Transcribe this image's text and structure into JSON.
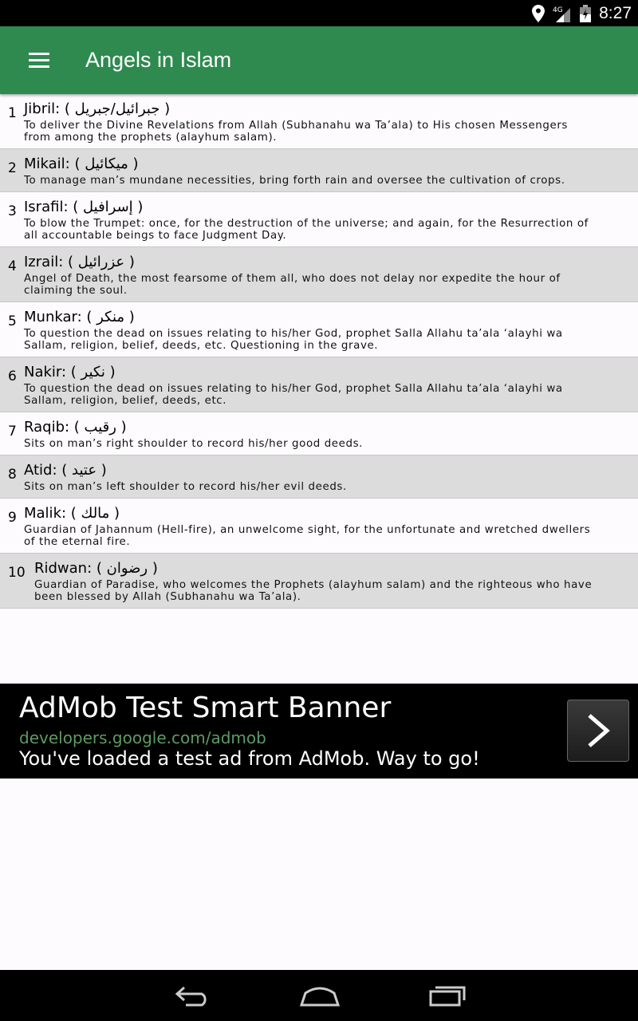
{
  "status": {
    "time": "8:27",
    "network": "4G"
  },
  "appbar": {
    "title": "Angels in Islam"
  },
  "angels": [
    {
      "num": "1",
      "name": "Jibril: ( جبرائيل/جبريل )",
      "desc": "To deliver the Divine Revelations from Allah (Subhanahu wa Ta’ala) to His chosen Messengers from among the prophets (alayhum salam)."
    },
    {
      "num": "2",
      "name": "Mikail: ( ميكائيل )",
      "desc": "To manage man’s mundane necessities, bring forth rain and oversee the cultivation of crops."
    },
    {
      "num": "3",
      "name": "Israfil: ( إسرافيل )",
      "desc": "To blow the Trumpet: once, for the destruction of the universe; and again, for the Resurrection of all accountable beings to face Judgment Day."
    },
    {
      "num": "4",
      "name": "Izrail: ( عزرائيل )",
      "desc": "Angel of Death, the most fearsome of them all, who does not delay nor expedite the hour of claiming the soul."
    },
    {
      "num": "5",
      "name": "Munkar: ( منكر )",
      "desc": "To question the dead on issues relating to his/her God, prophet Salla Allahu ta’ala ‘alayhi wa Sallam, religion, belief, deeds, etc. Questioning in the grave."
    },
    {
      "num": "6",
      "name": "Nakir: ( نكير )",
      "desc": "To question the dead on issues relating to his/her God, prophet Salla Allahu ta’ala ‘alayhi wa Sallam, religion, belief, deeds, etc."
    },
    {
      "num": "7",
      "name": "Raqib: ( رقيب )",
      "desc": "Sits on man’s right shoulder to record his/her good deeds."
    },
    {
      "num": "8",
      "name": "Atid: ( عتيد )",
      "desc": "Sits on man’s left shoulder to record his/her evil deeds."
    },
    {
      "num": "9",
      "name": "Malik: ( مالك )",
      "desc": "Guardian of Jahannum (Hell-fire), an unwelcome sight, for the unfortunate and wretched dwellers of the eternal fire."
    },
    {
      "num": "10",
      "name": "Ridwan: ( رضوان )",
      "desc": "Guardian of Paradise, who welcomes the Prophets (alayhum salam) and the righteous who have been blessed by Allah (Subhanahu wa Ta’ala)."
    }
  ],
  "ad": {
    "headline": "AdMob Test Smart Banner",
    "url": "developers.google.com/admob",
    "text": "You've loaded a test ad from AdMob. Way to go!"
  },
  "colors": {
    "appbar": "#2e8a4f",
    "alt_row": "#dcdcdc",
    "ad_url": "#5d9b62"
  }
}
